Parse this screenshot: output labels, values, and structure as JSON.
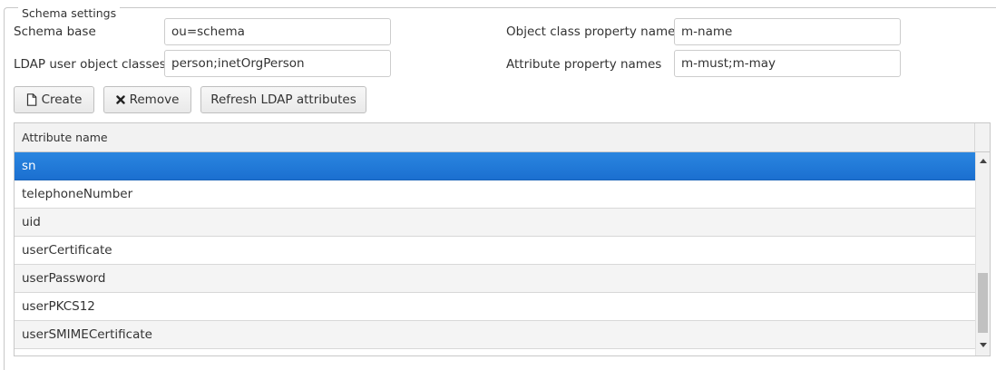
{
  "schema_settings": {
    "legend": "Schema settings",
    "schema_base": {
      "label": "Schema base",
      "value": "ou=schema"
    },
    "object_class_property_name": {
      "label": "Object class property name",
      "value": "m-name"
    },
    "ldap_user_object_classes": {
      "label": "LDAP user object classes",
      "value": "person;inetOrgPerson"
    },
    "attribute_property_names": {
      "label": "Attribute property names",
      "value": "m-must;m-may"
    }
  },
  "toolbar": {
    "create_label": "Create",
    "remove_label": "Remove",
    "refresh_label": "Refresh LDAP attributes"
  },
  "grid": {
    "column_header": "Attribute name",
    "rows": [
      "sn",
      "telephoneNumber",
      "uid",
      "userCertificate",
      "userPassword",
      "userPKCS12",
      "userSMIMECertificate"
    ],
    "selected_row": "sn"
  },
  "icons": {
    "create": "file-icon",
    "remove": "x-icon",
    "scroll_up": "arrow-up-icon",
    "scroll_down": "arrow-down-icon"
  },
  "colors": {
    "selection": "#1b75d8",
    "border": "#c8c8c8"
  }
}
